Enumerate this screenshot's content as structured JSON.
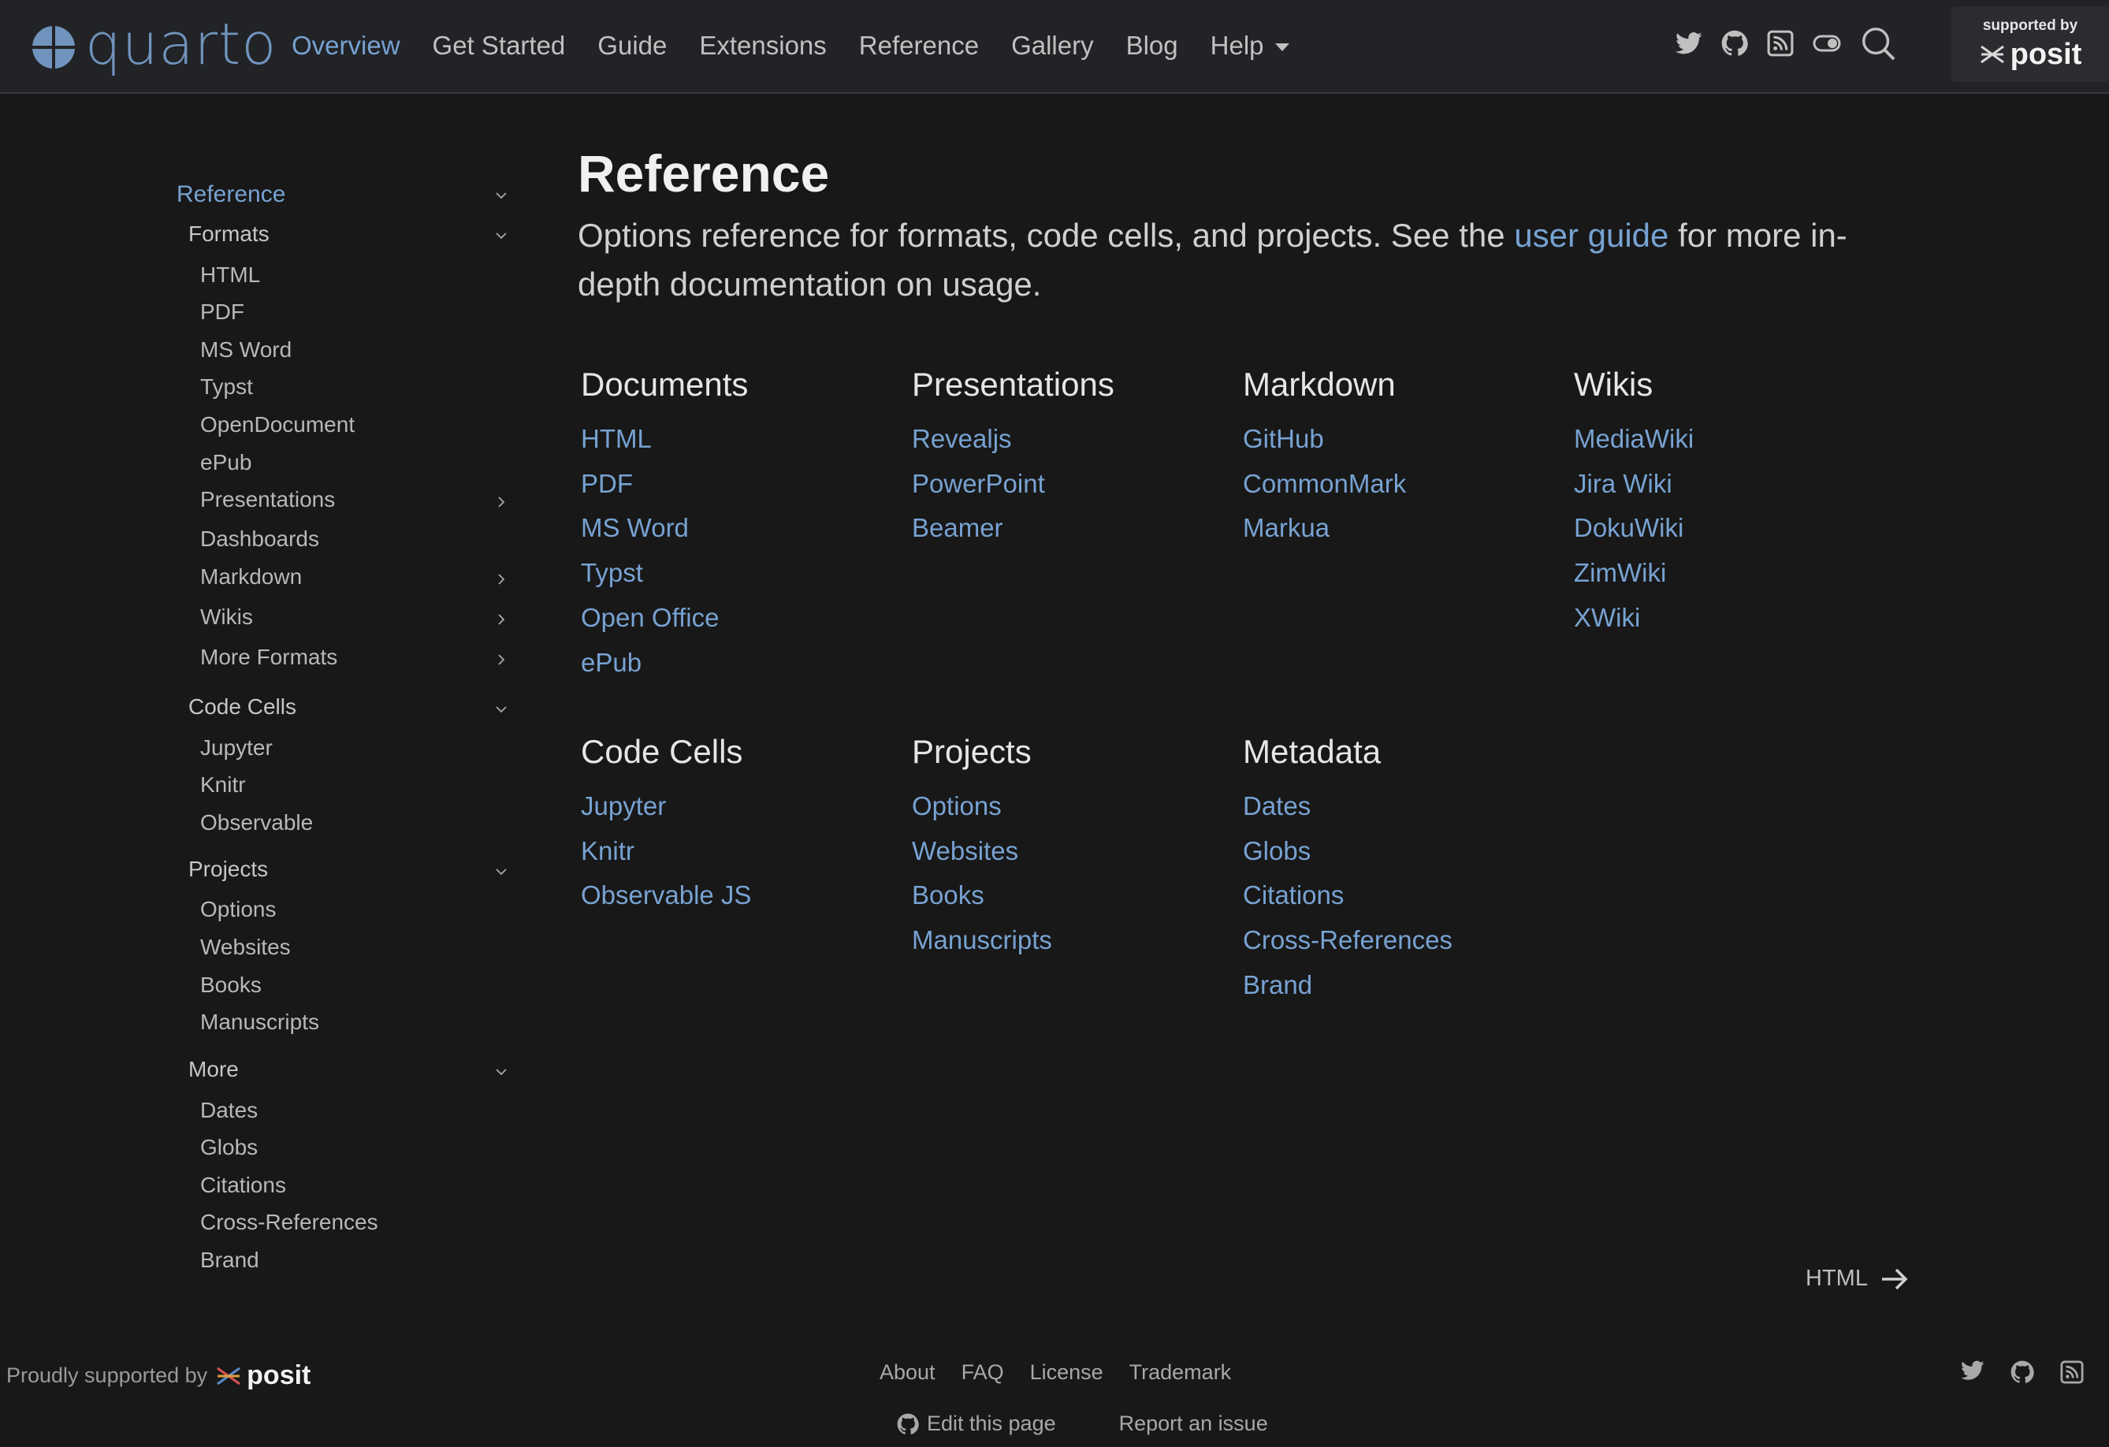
{
  "navbar": {
    "logo_text": "quarto",
    "links": [
      "Overview",
      "Get Started",
      "Guide",
      "Extensions",
      "Reference",
      "Gallery",
      "Blog"
    ],
    "help_label": "Help",
    "icons": [
      "twitter-icon",
      "github-icon",
      "rss-icon",
      "toggle-icon",
      "search-icon"
    ],
    "sponsor_top": "supported by",
    "sponsor_brand": "posit",
    "accent_color": "#77a2d2"
  },
  "sidebar": {
    "top_label": "Reference",
    "formats": {
      "label": "Formats",
      "items": [
        "HTML",
        "PDF",
        "MS Word",
        "Typst",
        "OpenDocument",
        "ePub",
        "Presentations",
        "Dashboards",
        "Markdown",
        "Wikis",
        "More Formats"
      ]
    },
    "code_cells": {
      "label": "Code Cells",
      "items": [
        "Jupyter",
        "Knitr",
        "Observable"
      ]
    },
    "projects": {
      "label": "Projects",
      "items": [
        "Options",
        "Websites",
        "Books",
        "Manuscripts"
      ]
    },
    "more": {
      "label": "More",
      "items": [
        "Dates",
        "Globs",
        "Citations",
        "Cross-References",
        "Brand"
      ]
    }
  },
  "main": {
    "title": "Reference",
    "lead_before": "Options reference for formats, code cells, and projects. See the ",
    "lead_link": "user guide",
    "lead_after": " for more in-depth documentation on usage.",
    "categories": [
      {
        "heading": "Documents",
        "links": [
          "HTML",
          "PDF",
          "MS Word",
          "Typst",
          "Open Office",
          "ePub"
        ]
      },
      {
        "heading": "Presentations",
        "links": [
          "Revealjs",
          "PowerPoint",
          "Beamer"
        ]
      },
      {
        "heading": "Markdown",
        "links": [
          "GitHub",
          "CommonMark",
          "Markua"
        ]
      },
      {
        "heading": "Wikis",
        "links": [
          "MediaWiki",
          "Jira Wiki",
          "DokuWiki",
          "ZimWiki",
          "XWiki"
        ]
      },
      {
        "heading": "Code Cells",
        "links": [
          "Jupyter",
          "Knitr",
          "Observable JS"
        ]
      },
      {
        "heading": "Projects",
        "links": [
          "Options",
          "Websites",
          "Books",
          "Manuscripts"
        ]
      },
      {
        "heading": "Metadata",
        "links": [
          "Dates",
          "Globs",
          "Citations",
          "Cross-References",
          "Brand"
        ]
      }
    ],
    "next_label": "HTML"
  },
  "footer": {
    "proudly": "Proudly supported by",
    "brand": "posit",
    "links": [
      "About",
      "FAQ",
      "License",
      "Trademark"
    ],
    "edit_label": "Edit this page",
    "report_label": "Report an issue",
    "icons": [
      "twitter-icon",
      "github-icon",
      "rss-icon"
    ]
  }
}
